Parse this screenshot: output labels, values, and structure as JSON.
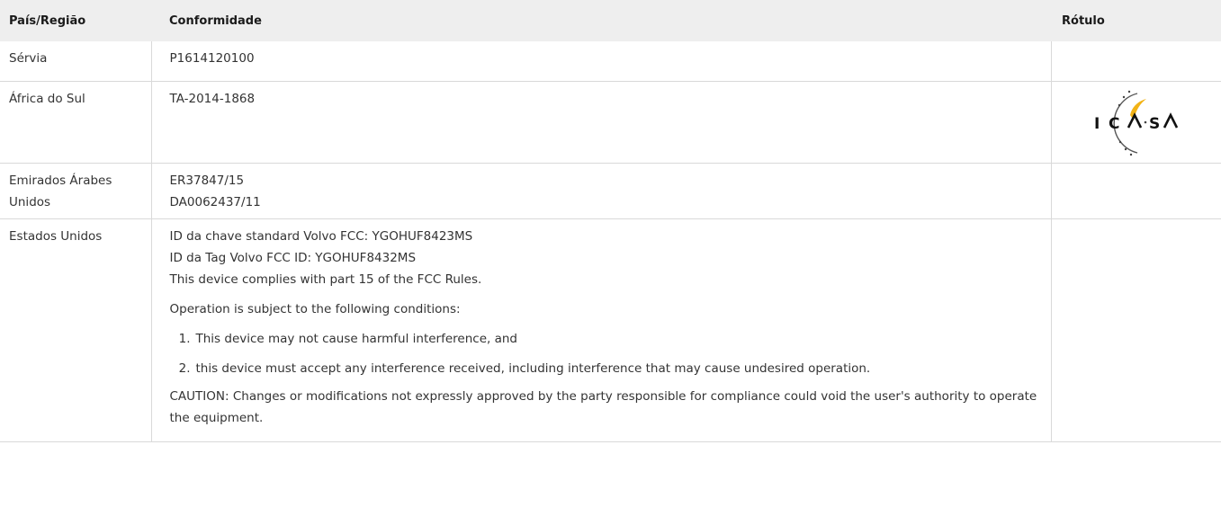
{
  "headers": {
    "country": "País/Região",
    "compliance": "Conformidade",
    "label": "Rótulo"
  },
  "rows": [
    {
      "country": "Sérvia",
      "compliance": [
        "P1614120100"
      ]
    },
    {
      "country": "África do Sul",
      "compliance": [
        "TA-2014-1868"
      ],
      "label_logo": {
        "name": "icasa-logo",
        "text": "ICASA"
      }
    },
    {
      "country": "Emirados Árabes Unidos",
      "compliance": [
        "ER37847/15",
        "DA0062437/11"
      ]
    },
    {
      "country": "Estados Unidos",
      "compliance": [
        "ID da chave standard Volvo FCC: YGOHUF8423MS",
        "ID da Tag Volvo FCC ID: YGOHUF8432MS",
        "This device complies with part 15 of the FCC Rules."
      ],
      "conditions_intro": "Operation is subject to the following conditions:",
      "conditions": [
        {
          "num": "1.",
          "text": "This device may not cause harmful interference, and"
        },
        {
          "num": "2.",
          "text": "this device must accept any interference received, including interference that may cause undesired operation."
        }
      ],
      "caution": "CAUTION: Changes or modifications not expressly approved by the party responsible for compliance could void the user's authority to operate the equipment."
    }
  ],
  "colors": {
    "header_bg": "#eeeeee",
    "border": "#d9d9d9",
    "logo_gold": "#f2b316",
    "text": "#333333"
  }
}
